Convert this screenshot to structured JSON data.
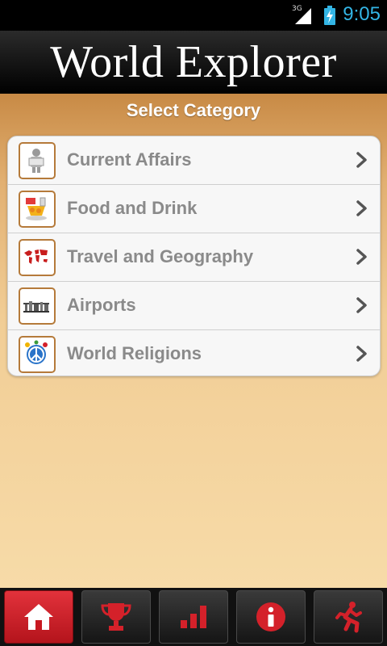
{
  "status_bar": {
    "network_label": "3G",
    "time": "9:05",
    "icons": [
      "signal-icon",
      "battery-charging-icon"
    ]
  },
  "header": {
    "title": "World Explorer"
  },
  "main": {
    "subtitle": "Select Category",
    "categories": [
      {
        "label": "Current Affairs",
        "icon": "newspaper-person-icon"
      },
      {
        "label": "Food and Drink",
        "icon": "food-drink-icon"
      },
      {
        "label": "Travel and Geography",
        "icon": "world-map-icon"
      },
      {
        "label": "Airports",
        "icon": "airport-icon"
      },
      {
        "label": "World Religions",
        "icon": "religion-symbols-icon"
      }
    ]
  },
  "bottom_nav": {
    "items": [
      {
        "name": "home",
        "icon": "home-icon",
        "active": true
      },
      {
        "name": "trophy",
        "icon": "trophy-icon",
        "active": false
      },
      {
        "name": "stats",
        "icon": "bar-chart-icon",
        "active": false
      },
      {
        "name": "info",
        "icon": "info-icon",
        "active": false
      },
      {
        "name": "exit",
        "icon": "running-man-icon",
        "active": false
      }
    ]
  },
  "colors": {
    "accent_red": "#d4212a",
    "time_blue": "#33b5e5",
    "label_gray": "#8a8a8a"
  }
}
